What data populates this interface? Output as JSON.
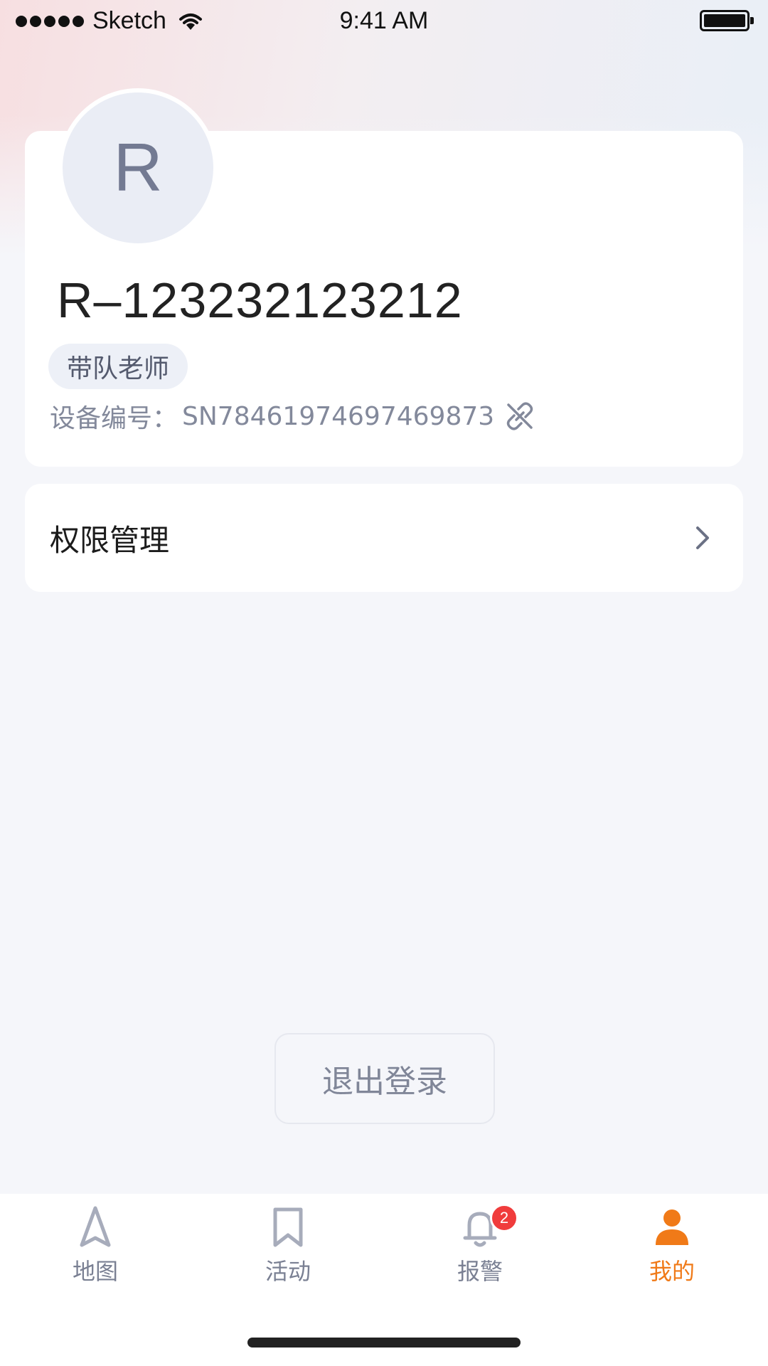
{
  "status_bar": {
    "carrier": "Sketch",
    "time": "9:41 AM"
  },
  "profile": {
    "avatar_letter": "R",
    "name": "R–123232123212",
    "role": "带队老师",
    "device_label": "设备编号：",
    "device_number": "SN78461974697469873",
    "unlink_icon": "link-broken-icon"
  },
  "menu": {
    "items": [
      {
        "label": "权限管理",
        "icon": "chevron-right-icon"
      }
    ]
  },
  "logout_label": "退出登录",
  "tab_bar": {
    "tabs": [
      {
        "label": "地图",
        "icon": "navigation-arrow-icon",
        "active": false
      },
      {
        "label": "活动",
        "icon": "bookmark-icon",
        "active": false
      },
      {
        "label": "报警",
        "icon": "bell-icon",
        "active": false,
        "badge": "2"
      },
      {
        "label": "我的",
        "icon": "person-icon",
        "active": true
      }
    ]
  },
  "colors": {
    "accent": "#f07a18",
    "badge": "#f03c3c",
    "tab_inactive": "#7a8093"
  }
}
